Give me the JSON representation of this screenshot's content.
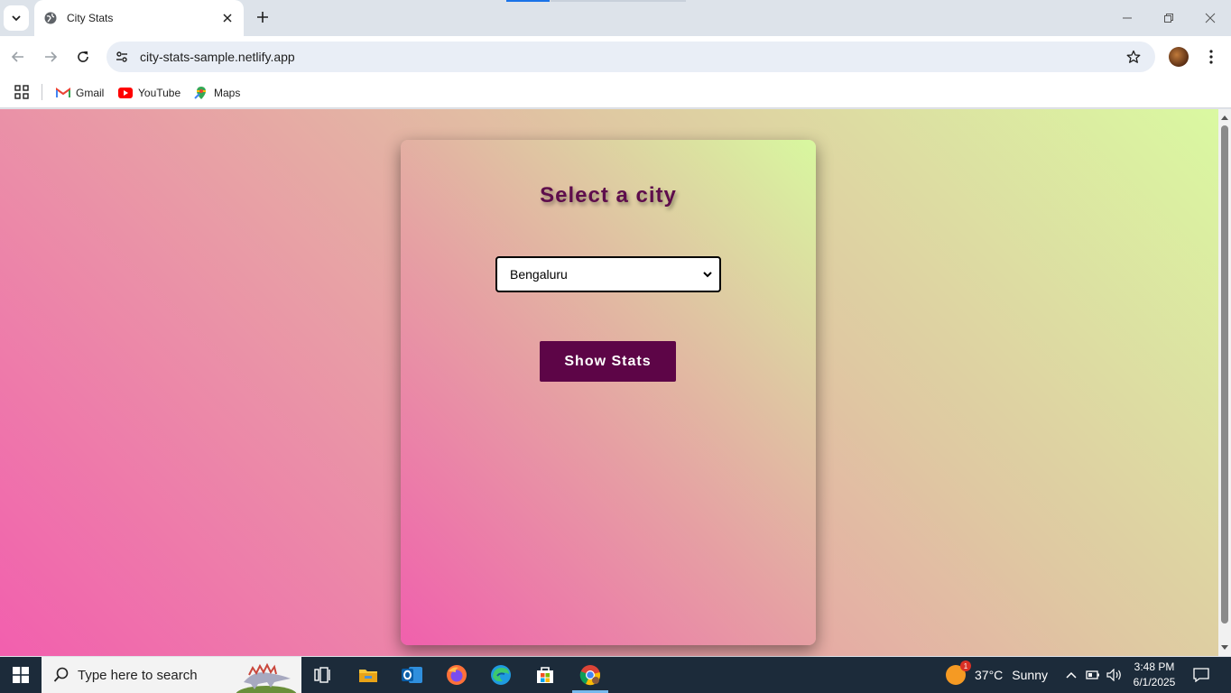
{
  "browser": {
    "tab_title": "City Stats",
    "url": "city-stats-sample.netlify.app",
    "bookmarks": [
      {
        "label": "Gmail",
        "icon": "gmail-icon"
      },
      {
        "label": "YouTube",
        "icon": "youtube-icon"
      },
      {
        "label": "Maps",
        "icon": "maps-icon"
      }
    ]
  },
  "page": {
    "heading": "Select a city",
    "city_select": {
      "selected": "Bengaluru"
    },
    "show_button": "Show Stats"
  },
  "taskbar": {
    "search_placeholder": "Type here to search",
    "weather": {
      "temp": "37°C",
      "condition": "Sunny",
      "badge": "1"
    },
    "clock": {
      "time": "3:48 PM",
      "date": "6/1/2025"
    }
  },
  "colors": {
    "accent": "#5d0547",
    "heading": "#5e0d4c",
    "gradient_pink": "#f25fae",
    "gradient_green": "#daf9a1"
  }
}
